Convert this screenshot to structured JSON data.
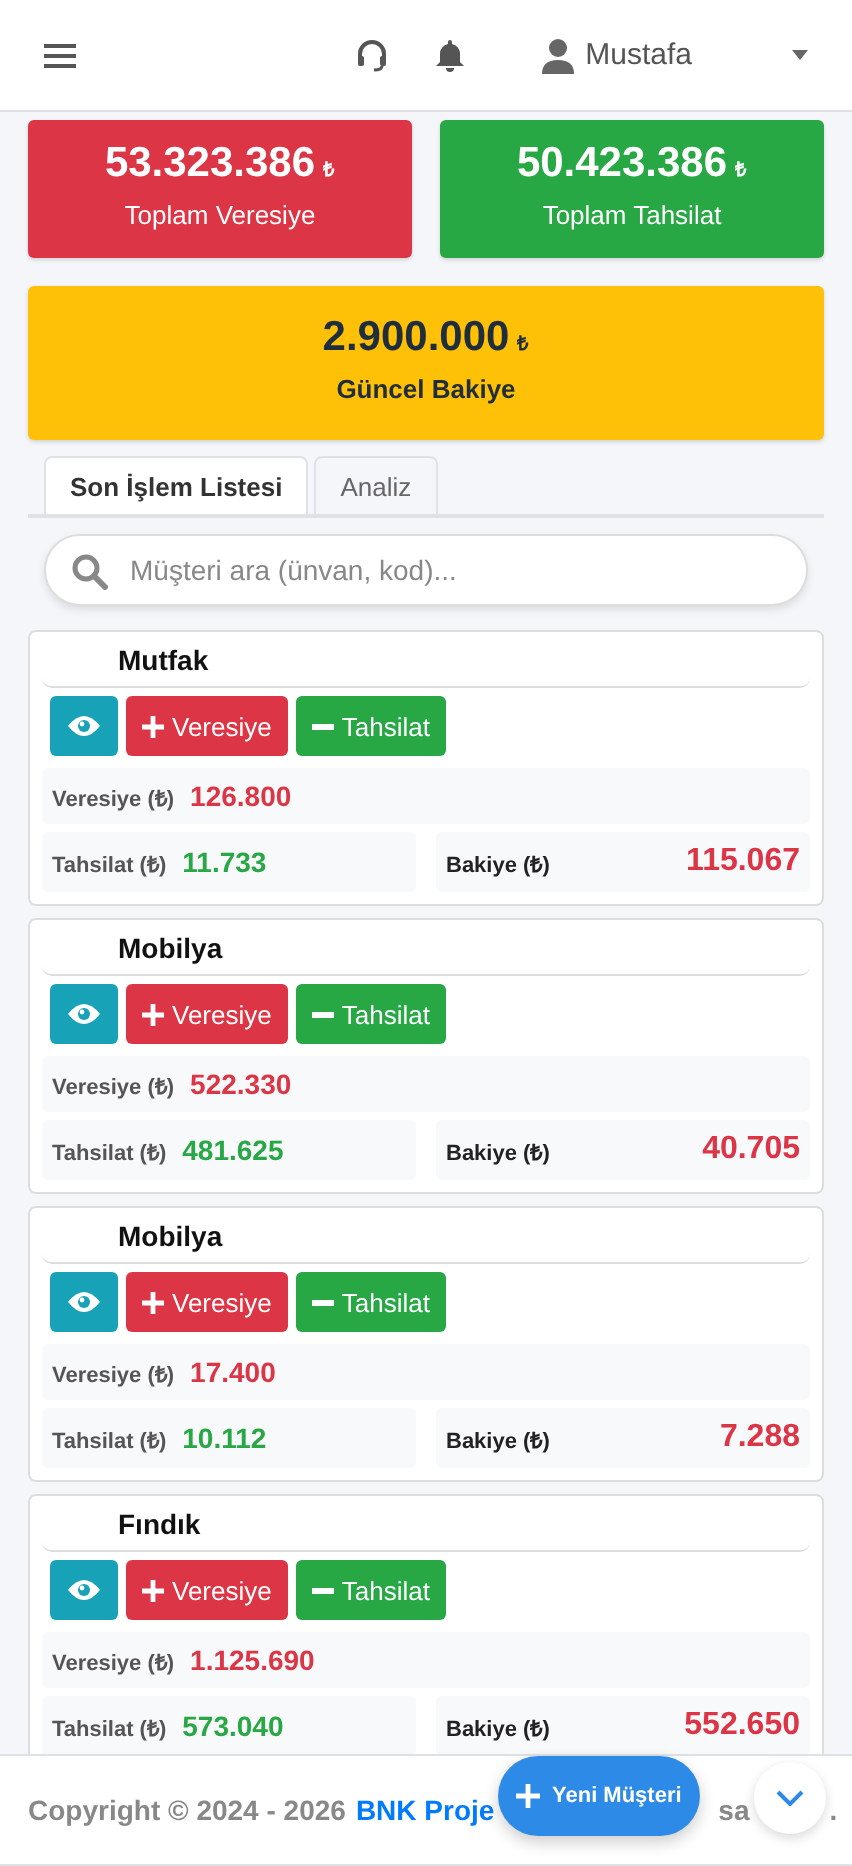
{
  "header": {
    "user_name": "Mustafa"
  },
  "summary": [
    {
      "amount": "53.323.386",
      "currency": "₺",
      "label": "Toplam Veresiye",
      "color": "#dc3545"
    },
    {
      "amount": "50.423.386",
      "currency": "₺",
      "label": "Toplam Tahsilat",
      "color": "#28a745"
    },
    {
      "amount": "2.900.000",
      "currency": "₺",
      "label": "Güncel Bakiye",
      "color": "#ffc107"
    }
  ],
  "tabs": [
    {
      "label": "Son İşlem Listesi",
      "selected": true
    },
    {
      "label": "Analiz",
      "selected": false
    }
  ],
  "search": {
    "placeholder": "Müşteri ara (ünvan, kod)..."
  },
  "customers": [
    {
      "name": "Mutfak",
      "add_label": "Veresiye",
      "collect_label": "Tahsilat",
      "credit_label": "Veresiye (₺)",
      "credit": "126.800",
      "collected_label": "Tahsilat (₺)",
      "collected": "11.733",
      "balance_label": "Bakiye (₺)",
      "balance": "115.067"
    },
    {
      "name": "Mobilya",
      "add_label": "Veresiye",
      "collect_label": "Tahsilat",
      "credit_label": "Veresiye (₺)",
      "credit": "522.330",
      "collected_label": "Tahsilat (₺)",
      "collected": "481.625",
      "balance_label": "Bakiye (₺)",
      "balance": "40.705"
    },
    {
      "name": "Mobilya",
      "add_label": "Veresiye",
      "collect_label": "Tahsilat",
      "credit_label": "Veresiye (₺)",
      "credit": "17.400",
      "collected_label": "Tahsilat (₺)",
      "collected": "10.112",
      "balance_label": "Bakiye (₺)",
      "balance": "7.288"
    },
    {
      "name": "Fındık",
      "add_label": "Veresiye",
      "collect_label": "Tahsilat",
      "credit_label": "Veresiye (₺)",
      "credit": "1.125.690",
      "collected_label": "Tahsilat (₺)",
      "collected": "573.040",
      "balance_label": "Bakiye (₺)",
      "balance": "552.650"
    }
  ],
  "footer": {
    "copyright": "Copyright © 2024 - 2026",
    "link": "BNK Proje",
    "tail": "sa",
    "end": "."
  },
  "new_customer_button": "Yeni Müşteri"
}
